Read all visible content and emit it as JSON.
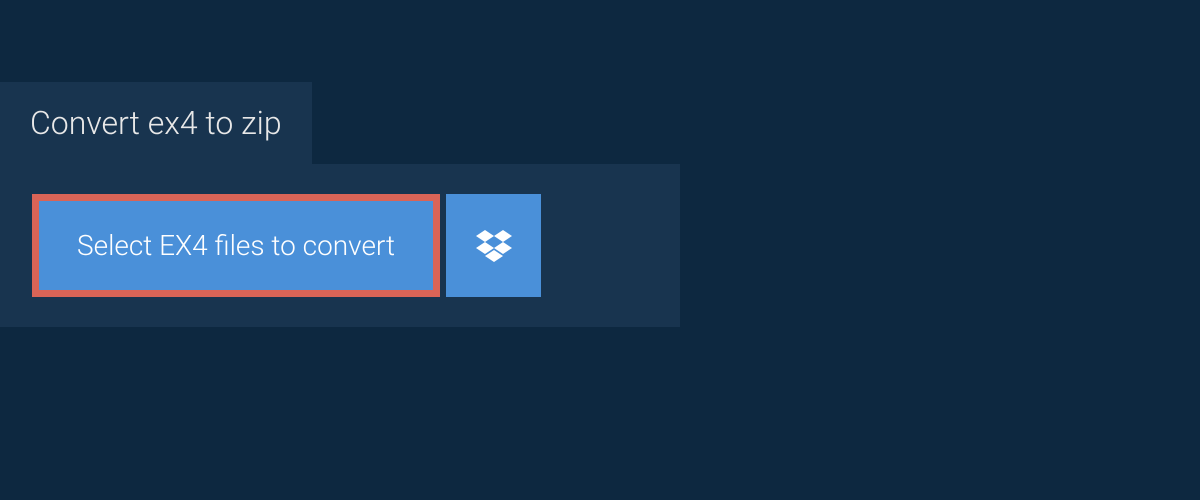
{
  "header": {
    "title": "Convert ex4 to zip"
  },
  "main": {
    "select_button_label": "Select EX4 files to convert"
  },
  "colors": {
    "background": "#0d2840",
    "panel": "#18344f",
    "button": "#4a90d9",
    "highlight_border": "#d96457"
  }
}
